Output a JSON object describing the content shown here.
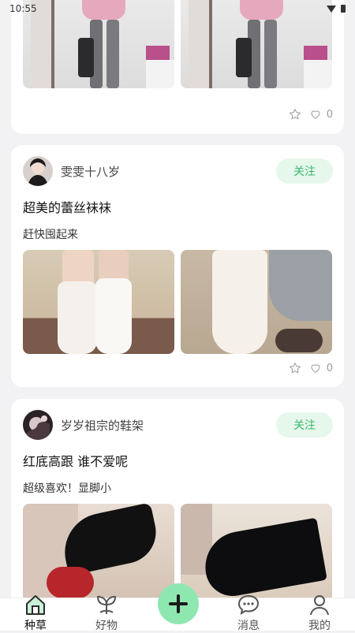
{
  "status_bar": {
    "time": "10:55"
  },
  "posts": [
    {
      "author": "",
      "title": "",
      "description": "",
      "likes": "0",
      "images": [
        "photo-room-pink-top",
        "photo-room-pink-top-2"
      ]
    },
    {
      "author": "雯雯十八岁",
      "follow_label": "关注",
      "title": "超美的蕾丝袜袜",
      "description": "赶快囤起来",
      "likes": "0",
      "images": [
        "photo-lace-socks-1",
        "photo-lace-socks-2"
      ]
    },
    {
      "author": "岁岁祖宗的鞋架",
      "follow_label": "关注",
      "title": "红底高跟 谁不爱呢",
      "description": "超级喜欢！显脚小",
      "images": [
        "photo-heels-1",
        "photo-heels-2"
      ]
    }
  ],
  "tab_bar": {
    "items": [
      {
        "label": "种草",
        "icon": "home-icon",
        "active": true
      },
      {
        "label": "好物",
        "icon": "sprout-icon",
        "active": false
      },
      {
        "label": "消息",
        "icon": "chat-icon",
        "active": false
      },
      {
        "label": "我的",
        "icon": "person-icon",
        "active": false
      }
    ],
    "fab_icon": "plus-icon"
  },
  "colors": {
    "accent": "#3bb86b",
    "follow_bg": "#e6f7ec",
    "fab_bg": "#8fe7b0",
    "background": "#f2f2f4"
  }
}
